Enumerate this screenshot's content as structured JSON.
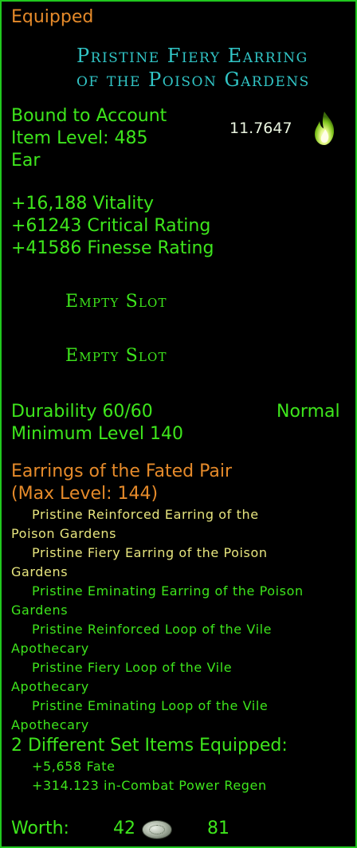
{
  "header": {
    "equipped_label": "Equipped"
  },
  "item": {
    "name_line1": "Pristine Fiery Earring",
    "name_line2": "of the Poison Gardens",
    "binding": "Bound to Account",
    "item_level": "Item Level: 485",
    "slot": "Ear",
    "score": "11.7647",
    "score_icon": "green-flame-icon"
  },
  "stats": [
    "+16,188 Vitality",
    "+61243 Critical Rating",
    "+41586 Finesse Rating"
  ],
  "essence_slots": [
    "Empty Slot",
    "Empty Slot"
  ],
  "durability": {
    "label": "Durability 60/60",
    "quality": "Normal"
  },
  "min_level": "Minimum Level 140",
  "set": {
    "name": "Earrings of the Fated Pair",
    "max_level": "(Max Level: 144)",
    "items": [
      {
        "line1": "Pristine Reinforced Earring of the",
        "line2": "Poison Gardens"
      },
      {
        "line1": "Pristine Fiery Earring of the Poison",
        "line2": "Gardens"
      },
      {
        "line1": "Pristine Eminating Earring of the Poison",
        "line2": "Gardens"
      },
      {
        "line1": "Pristine Reinforced Loop of the Vile",
        "line2": "Apothecary"
      },
      {
        "line1": "Pristine Fiery Loop of the Vile",
        "line2": "Apothecary"
      },
      {
        "line1": "Pristine Eminating Loop of the Vile",
        "line2": "Apothecary"
      }
    ],
    "bonus_header": "2 Different Set Items Equipped:",
    "bonuses": [
      "+5,658 Fate",
      "+314.123 in-Combat Power Regen"
    ]
  },
  "worth": {
    "label": "Worth:",
    "gold": "42",
    "coin_icon": "silver-coin-icon",
    "silver": "81"
  },
  "colors": {
    "border": "#20c81e",
    "header_orange": "#e58a2a",
    "name_cyan": "#31c5c6",
    "stat_green": "#3ee61c",
    "set_item_yellow": "#e7e57e"
  }
}
